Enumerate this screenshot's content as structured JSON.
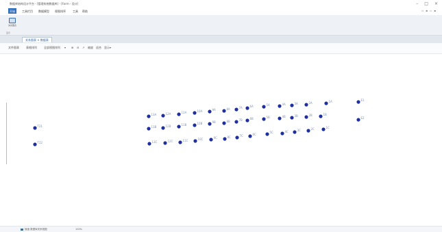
{
  "window": {
    "title": "数据库结构设计平台 - [管理系统数据库] - [Form - 设计]",
    "controls": [
      "–",
      "□",
      "×"
    ]
  },
  "menubar": {
    "items": [
      "开始",
      "工具栏目",
      "数据模型",
      "视图排序",
      "工具",
      "帮助"
    ],
    "active_index": 0,
    "right_tools": "▫ ▪ ▫ ▪"
  },
  "ribbon": {
    "button_label": "关系图表",
    "group_label": "显示"
  },
  "tabstrip": {
    "tab_label": "关系图表 ×  数据表"
  },
  "viewbar": {
    "items": [
      "文件图表",
      "表格排列",
      "全部视图排列",
      "▾",
      "⊞",
      "⊟",
      "↗",
      "缩放",
      "适合",
      "显示▾"
    ]
  },
  "diagram": {
    "node_color": "#1f2f9e",
    "label_color": "#7a8fb0",
    "nodes": [
      {
        "label": "T21"
      },
      {
        "label": "T22"
      },
      {
        "label": "13A"
      },
      {
        "label": "12A"
      },
      {
        "label": "11A"
      },
      {
        "label": "10A"
      },
      {
        "label": "9A"
      },
      {
        "label": "8A"
      },
      {
        "label": "7A"
      },
      {
        "label": "6A"
      },
      {
        "label": "5A"
      },
      {
        "label": "4A"
      },
      {
        "label": "3A"
      },
      {
        "label": "2A"
      },
      {
        "label": "1A"
      },
      {
        "label": "13B"
      },
      {
        "label": "12B"
      },
      {
        "label": "11B"
      },
      {
        "label": "10B"
      },
      {
        "label": "9B"
      },
      {
        "label": "8B"
      },
      {
        "label": "7B"
      },
      {
        "label": "6B"
      },
      {
        "label": "5B"
      },
      {
        "label": "4B"
      },
      {
        "label": "3B"
      },
      {
        "label": "2B"
      },
      {
        "label": "1B"
      },
      {
        "label": "13C"
      },
      {
        "label": "12C"
      },
      {
        "label": "11C"
      },
      {
        "label": "10C"
      },
      {
        "label": "9C"
      },
      {
        "label": "8C"
      },
      {
        "label": "7C"
      },
      {
        "label": "6C"
      },
      {
        "label": "5C"
      },
      {
        "label": "4C"
      },
      {
        "label": "3C"
      },
      {
        "label": "2C"
      },
      {
        "label": "1C"
      },
      {
        "label": "E1"
      },
      {
        "label": "E2"
      }
    ]
  },
  "statusbar": {
    "left": "就绪 数据库关系视图",
    "right": "100%"
  }
}
